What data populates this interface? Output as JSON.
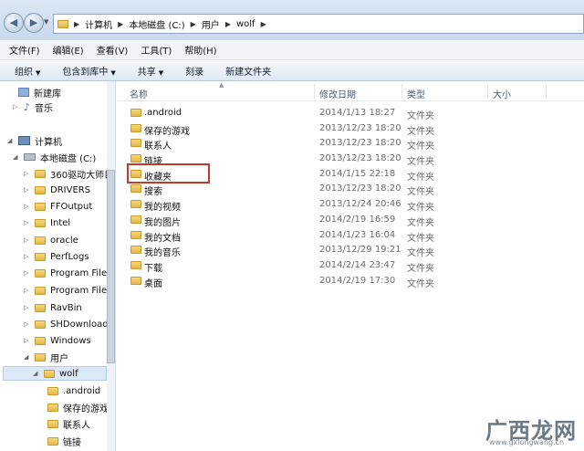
{
  "address": {
    "crumbs": [
      "计算机",
      "本地磁盘 (C:)",
      "用户",
      "wolf"
    ]
  },
  "menu": [
    {
      "label": "文件(F)"
    },
    {
      "label": "编辑(E)"
    },
    {
      "label": "查看(V)"
    },
    {
      "label": "工具(T)"
    },
    {
      "label": "帮助(H)"
    }
  ],
  "toolbar": [
    {
      "label": "组织",
      "dropdown": true
    },
    {
      "label": "包含到库中",
      "dropdown": true
    },
    {
      "label": "共享",
      "dropdown": true
    },
    {
      "label": "刻录",
      "dropdown": false
    },
    {
      "label": "新建文件夹",
      "dropdown": false
    }
  ],
  "nav": {
    "items": [
      {
        "label": "新建库",
        "icon": "library-icon"
      },
      {
        "label": "音乐",
        "icon": "music-icon"
      },
      {
        "label": "计算机",
        "icon": "computer-icon"
      },
      {
        "label": "本地磁盘 (C:)",
        "icon": "drive-icon"
      },
      {
        "label": "360驱动大师目",
        "icon": "folder-icon"
      },
      {
        "label": "DRIVERS",
        "icon": "folder-icon"
      },
      {
        "label": "FFOutput",
        "icon": "folder-icon"
      },
      {
        "label": "Intel",
        "icon": "folder-icon"
      },
      {
        "label": "oracle",
        "icon": "folder-icon"
      },
      {
        "label": "PerfLogs",
        "icon": "folder-icon"
      },
      {
        "label": "Program Files",
        "icon": "folder-icon"
      },
      {
        "label": "Program Files",
        "icon": "folder-icon"
      },
      {
        "label": "RavBin",
        "icon": "folder-icon"
      },
      {
        "label": "SHDownload",
        "icon": "folder-icon"
      },
      {
        "label": "Windows",
        "icon": "folder-icon"
      },
      {
        "label": "用户",
        "icon": "folder-icon"
      },
      {
        "label": "wolf",
        "icon": "user-folder-icon"
      },
      {
        "label": ".android",
        "icon": "folder-icon"
      },
      {
        "label": "保存的游戏",
        "icon": "folder-icon"
      },
      {
        "label": "联系人",
        "icon": "folder-icon"
      },
      {
        "label": "链接",
        "icon": "folder-icon"
      }
    ]
  },
  "columns": {
    "name": "名称",
    "date": "修改日期",
    "type": "类型",
    "size": "大小"
  },
  "files": [
    {
      "name": ".android",
      "date": "2014/1/13 18:27",
      "type": "文件夹"
    },
    {
      "name": "保存的游戏",
      "date": "2013/12/23 18:20",
      "type": "文件夹"
    },
    {
      "name": "联系人",
      "date": "2013/12/23 18:20",
      "type": "文件夹"
    },
    {
      "name": "链接",
      "date": "2013/12/23 18:20",
      "type": "文件夹"
    },
    {
      "name": "收藏夹",
      "date": "2014/1/15 22:18",
      "type": "文件夹"
    },
    {
      "name": "搜索",
      "date": "2013/12/23 18:20",
      "type": "文件夹"
    },
    {
      "name": "我的视频",
      "date": "2013/12/24 20:46",
      "type": "文件夹"
    },
    {
      "name": "我的图片",
      "date": "2014/2/19 16:59",
      "type": "文件夹"
    },
    {
      "name": "我的文档",
      "date": "2014/1/23 16:04",
      "type": "文件夹"
    },
    {
      "name": "我的音乐",
      "date": "2013/12/29 19:21",
      "type": "文件夹"
    },
    {
      "name": "下载",
      "date": "2014/2/14 23:47",
      "type": "文件夹"
    },
    {
      "name": "桌面",
      "date": "2014/2/19 17:30",
      "type": "文件夹"
    }
  ],
  "watermark": {
    "text": "广西龙网",
    "sub": "www.gxlongwang.cn"
  }
}
